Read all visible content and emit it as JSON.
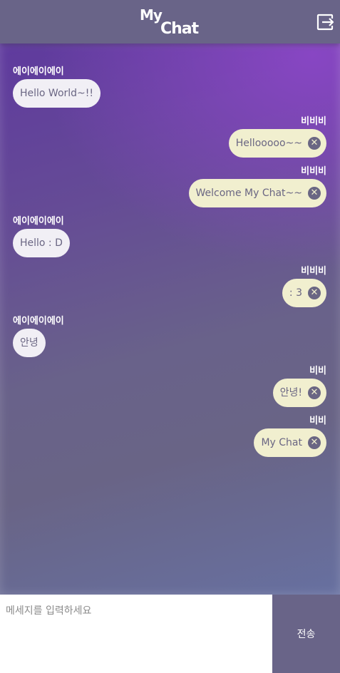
{
  "header": {
    "logo_line1": "My",
    "logo_line2": "Chat",
    "exit_icon": "logout-icon"
  },
  "colors": {
    "header_bg": "#696488",
    "received_bubble": "#f1eff5",
    "sent_bubble": "#f1efcf",
    "text": "#6a6683"
  },
  "messages": [
    {
      "side": "left",
      "sender": "에이에이에이",
      "text": "Hello World~!!"
    },
    {
      "side": "right",
      "sender": "비비비",
      "text": "Hellooooo~~"
    },
    {
      "side": "right",
      "sender": "비비비",
      "text": "Welcome My Chat~~"
    },
    {
      "side": "left",
      "sender": "에이에이에이",
      "text": "Hello : D"
    },
    {
      "side": "right",
      "sender": "비비비",
      "text": ": 3"
    },
    {
      "side": "left",
      "sender": "에이에이에이",
      "text": "안녕"
    },
    {
      "side": "right",
      "sender": "비비",
      "text": "안녕!"
    },
    {
      "side": "right",
      "sender": "비비",
      "text": "My Chat"
    }
  ],
  "delete_icon": "close-circle-icon",
  "input": {
    "placeholder": "메세지를 입력하세요",
    "value": ""
  },
  "send_label": "전송"
}
